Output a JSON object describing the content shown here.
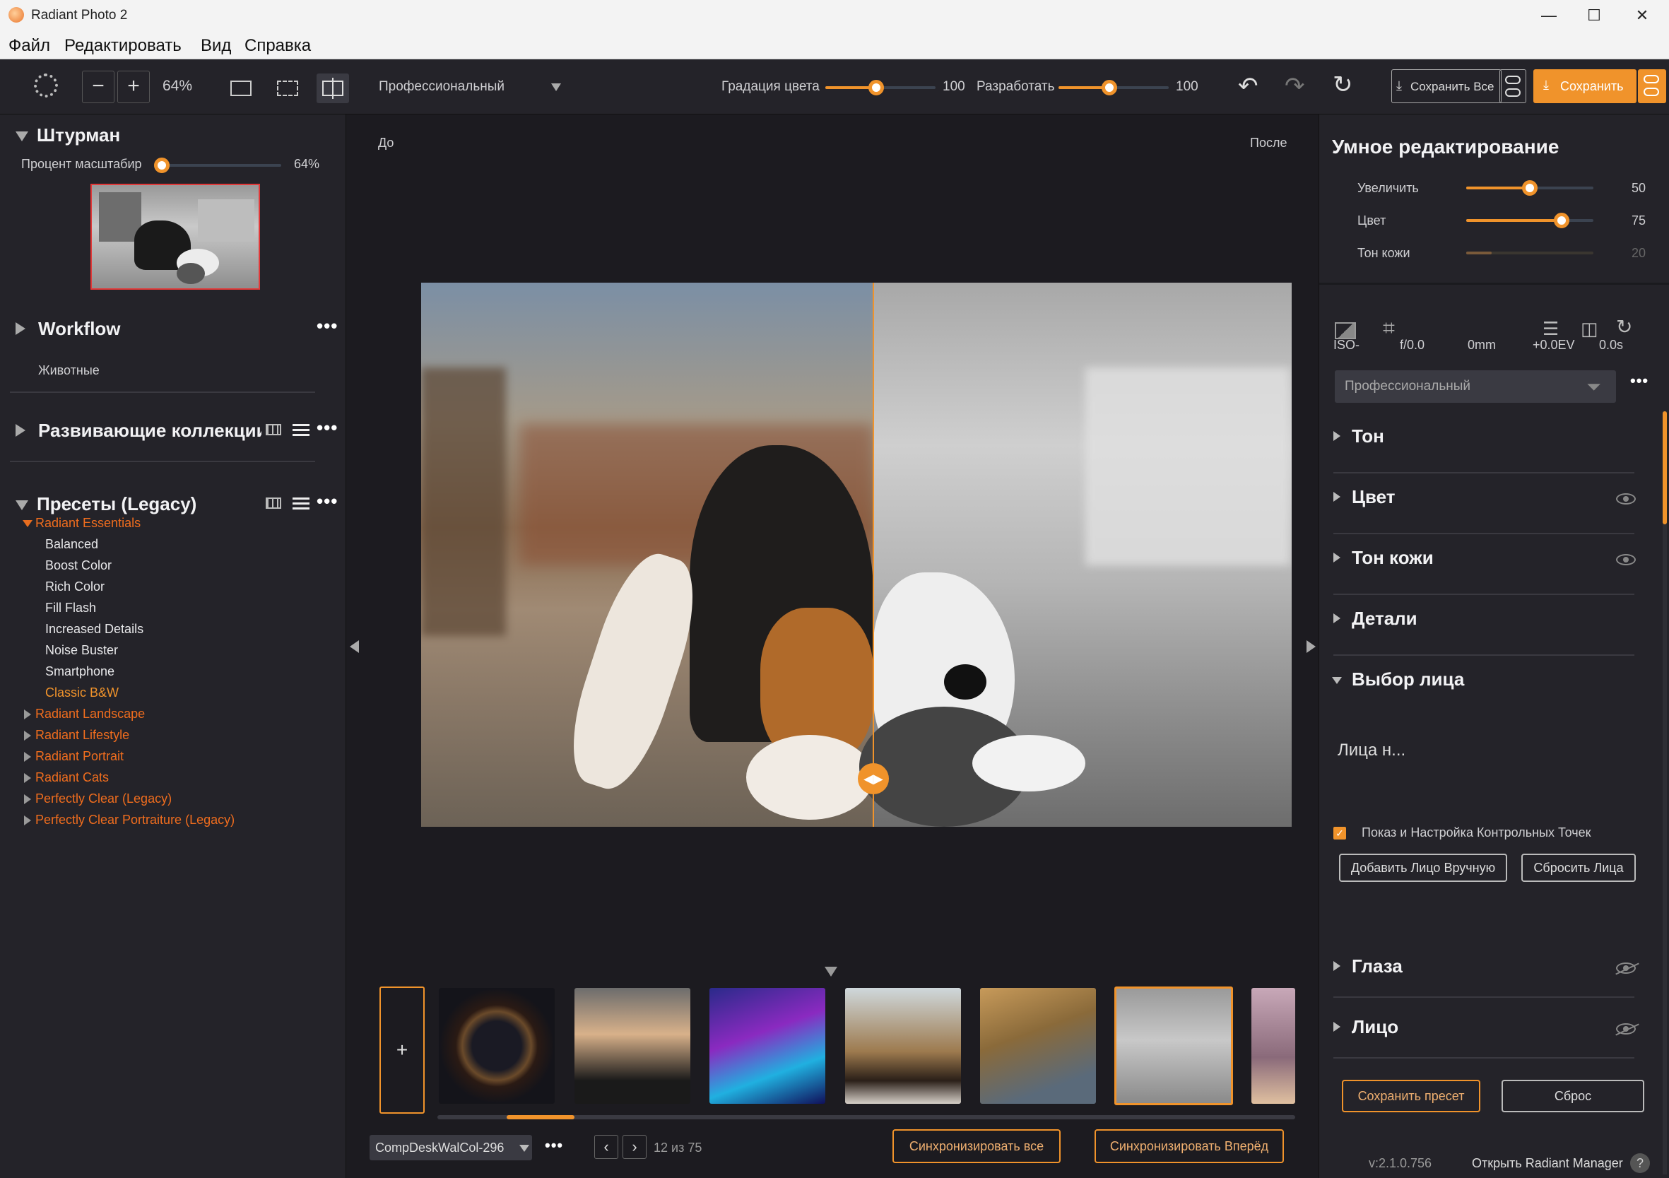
{
  "window": {
    "title": "Radiant Photo 2"
  },
  "menu": [
    "Файл",
    "Редактировать",
    "Вид",
    "Справка"
  ],
  "toolbar": {
    "zoom": "64%",
    "mode": "Профессиональный",
    "gradation_label": "Градация цвета",
    "gradation_value": "100",
    "gradation_level": 0.46,
    "develop_label": "Разработать",
    "develop_value": "100",
    "develop_level": 0.46,
    "save_all": "Сохранить Все",
    "save": "Сохранить"
  },
  "navigator": {
    "title": "Штурман",
    "zoom_label": "Процент масштабир",
    "zoom_value": "64%"
  },
  "workflow": {
    "title": "Workflow",
    "item": "Животные"
  },
  "collections": {
    "title": "Развивающие коллекции"
  },
  "presets": {
    "title": "Пресеты (Legacy)",
    "open_category": "Radiant Essentials",
    "items": [
      "Balanced",
      "Boost Color",
      "Rich Color",
      "Fill Flash",
      "Increased Details",
      "Noise Buster",
      "Smartphone",
      "Classic B&W"
    ],
    "categories": [
      "Radiant Landscape",
      "Radiant Lifestyle",
      "Radiant Portrait",
      "Radiant Cats",
      "Perfectly Clear (Legacy)",
      "Perfectly Clear Portraiture (Legacy)"
    ]
  },
  "canvas": {
    "before": "До",
    "after": "После"
  },
  "filmstrip": {
    "folder": "CompDeskWalCol-296",
    "counter": "12 из 75",
    "sync_all": "Синхронизировать все",
    "sync_forward": "Синхронизировать Вперёд"
  },
  "smart_edit": {
    "title": "Умное редактирование",
    "sliders": [
      {
        "label": "Увеличить",
        "value": "50",
        "level": 0.5
      },
      {
        "label": "Цвет",
        "value": "75",
        "level": 0.75
      },
      {
        "label": "Тон кожи",
        "value": "20",
        "level": 0.2
      }
    ]
  },
  "exif": [
    "ISO-",
    "f/0.0",
    "0mm",
    "+0.0EV",
    "0.0s"
  ],
  "profile": "Профессиональный",
  "sections": [
    "Тон",
    "Цвет",
    "Тон кожи",
    "Детали",
    "Выбор лица"
  ],
  "face": {
    "status": "Лица н...",
    "checkbox_label": "Показ и Настройка Контрольных Точек",
    "add_face": "Добавить Лицо Вручную",
    "reset_faces": "Сбросить Лица"
  },
  "sections2": [
    "Глаза",
    "Лицо"
  ],
  "footer": {
    "save_preset": "Сохранить пресет",
    "reset": "Сброс",
    "version": "v:2.1.0.756",
    "open_manager": "Открыть Radiant Manager",
    "help": "?"
  },
  "colors": {
    "accent": "#f0932b",
    "category": "#f06d1e",
    "bg": "#1c1b20",
    "panel": "#242329"
  }
}
